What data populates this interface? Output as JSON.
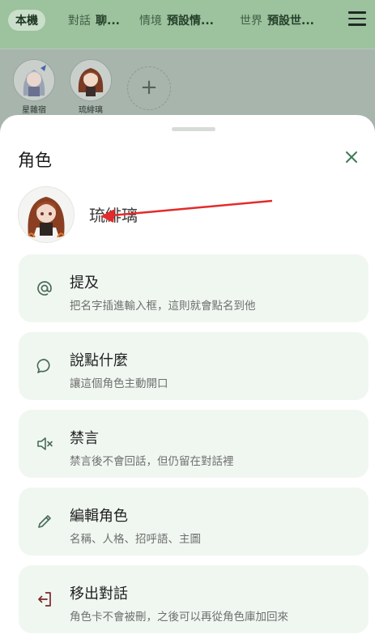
{
  "tabs": [
    {
      "label": "本機",
      "value": ""
    },
    {
      "label": "對話",
      "value": "聊..."
    },
    {
      "label": "情境",
      "value": "預設情..."
    },
    {
      "label": "世界",
      "value": "預設世..."
    }
  ],
  "characters": [
    {
      "name": "星雜宿"
    },
    {
      "name": "琉緋璃"
    }
  ],
  "add_icon": "+",
  "sheet": {
    "title": "角色",
    "selected_name": "琉緋璃",
    "actions": [
      {
        "icon": "at-icon",
        "title": "提及",
        "desc": "把名字插進輸入框，這則就會點名到他"
      },
      {
        "icon": "chat-bubble-icon",
        "title": "說點什麼",
        "desc": "讓這個角色主動開口"
      },
      {
        "icon": "mute-icon",
        "title": "禁言",
        "desc": "禁言後不會回話，但仍留在對話裡"
      },
      {
        "icon": "pencil-icon",
        "title": "編輯角色",
        "desc": "名稱、人格、招呼語、主圖"
      },
      {
        "icon": "exit-icon",
        "title": "移出對話",
        "desc": "角色卡不會被刪，之後可以再從角色庫加回來"
      }
    ]
  },
  "colors": {
    "accent": "#3e7a55",
    "annotation_arrow": "#e32b2b"
  }
}
